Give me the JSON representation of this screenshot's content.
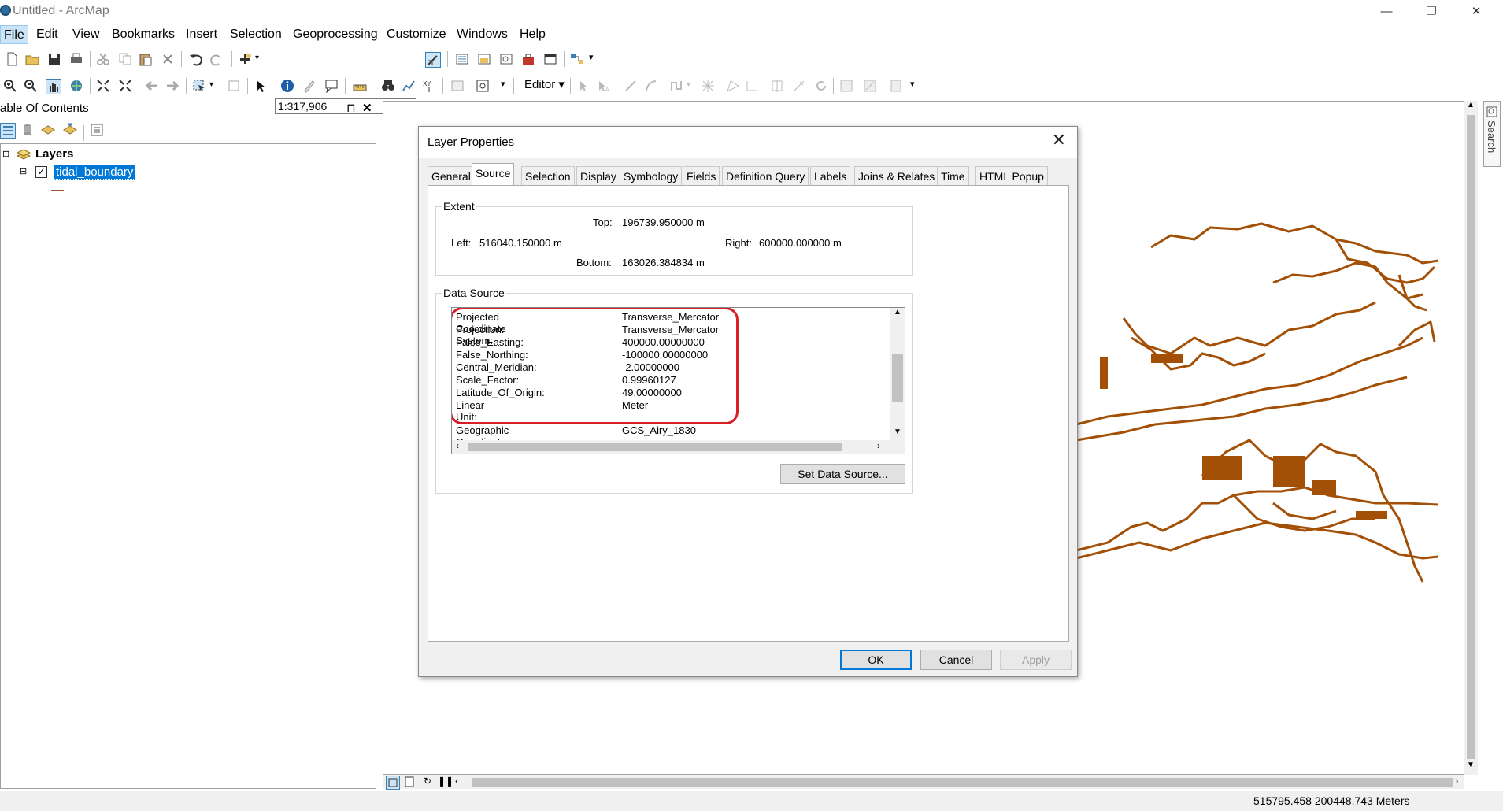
{
  "window": {
    "title": "Untitled - ArcMap",
    "minimize": "—",
    "restore": "❐",
    "close": "✕"
  },
  "menu": [
    "File",
    "Edit",
    "View",
    "Bookmarks",
    "Insert",
    "Selection",
    "Geoprocessing",
    "Customize",
    "Windows",
    "Help"
  ],
  "toolbar": {
    "scale": "1:317,906",
    "editor_label": "Editor"
  },
  "toc": {
    "title": "able Of Contents",
    "pin": "ᵖ",
    "close": "✕",
    "root_label": "Layers",
    "layer_name": "tidal_boundary",
    "layer_checked": true,
    "layer_color": "#a0522d"
  },
  "dialog": {
    "title": "Layer Properties",
    "tabs": [
      "General",
      "Source",
      "Selection",
      "Display",
      "Symbology",
      "Fields",
      "Definition Query",
      "Labels",
      "Joins & Relates",
      "Time",
      "HTML Popup"
    ],
    "active_tab": "Source",
    "extent": {
      "group_label": "Extent",
      "top_label": "Top:",
      "top": "196739.950000 m",
      "left_label": "Left:",
      "left": "516040.150000 m",
      "right_label": "Right:",
      "right": "600000.000000 m",
      "bottom_label": "Bottom:",
      "bottom": "163026.384834 m"
    },
    "data_source": {
      "group_label": "Data Source",
      "rows": [
        {
          "key": "Projected Coordinate System:",
          "value": "Transverse_Mercator"
        },
        {
          "key": "Projection:",
          "value": "Transverse_Mercator"
        },
        {
          "key": "False_Easting:",
          "value": "400000.00000000"
        },
        {
          "key": "False_Northing:",
          "value": "-100000.00000000"
        },
        {
          "key": "Central_Meridian:",
          "value": "-2.00000000"
        },
        {
          "key": "Scale_Factor:",
          "value": "0.99960127"
        },
        {
          "key": "Latitude_Of_Origin:",
          "value": "49.00000000"
        },
        {
          "key": "Linear Unit:",
          "value": "Meter"
        },
        {
          "key": "",
          "value": ""
        },
        {
          "key": "Geographic Coordinate System:",
          "value": "GCS_Airy_1830"
        }
      ],
      "set_button": "Set Data Source..."
    },
    "buttons": {
      "ok": "OK",
      "cancel": "Cancel",
      "apply": "Apply"
    },
    "close": "✕"
  },
  "map": {
    "feature_color": "#a34f05"
  },
  "search_tab": "Search",
  "status": {
    "coordinates": "515795.458  200448.743 Meters"
  },
  "colors": {
    "accent": "#0078d7",
    "highlight_ring": "#d81f26",
    "selected_layer": "#0078d7"
  }
}
